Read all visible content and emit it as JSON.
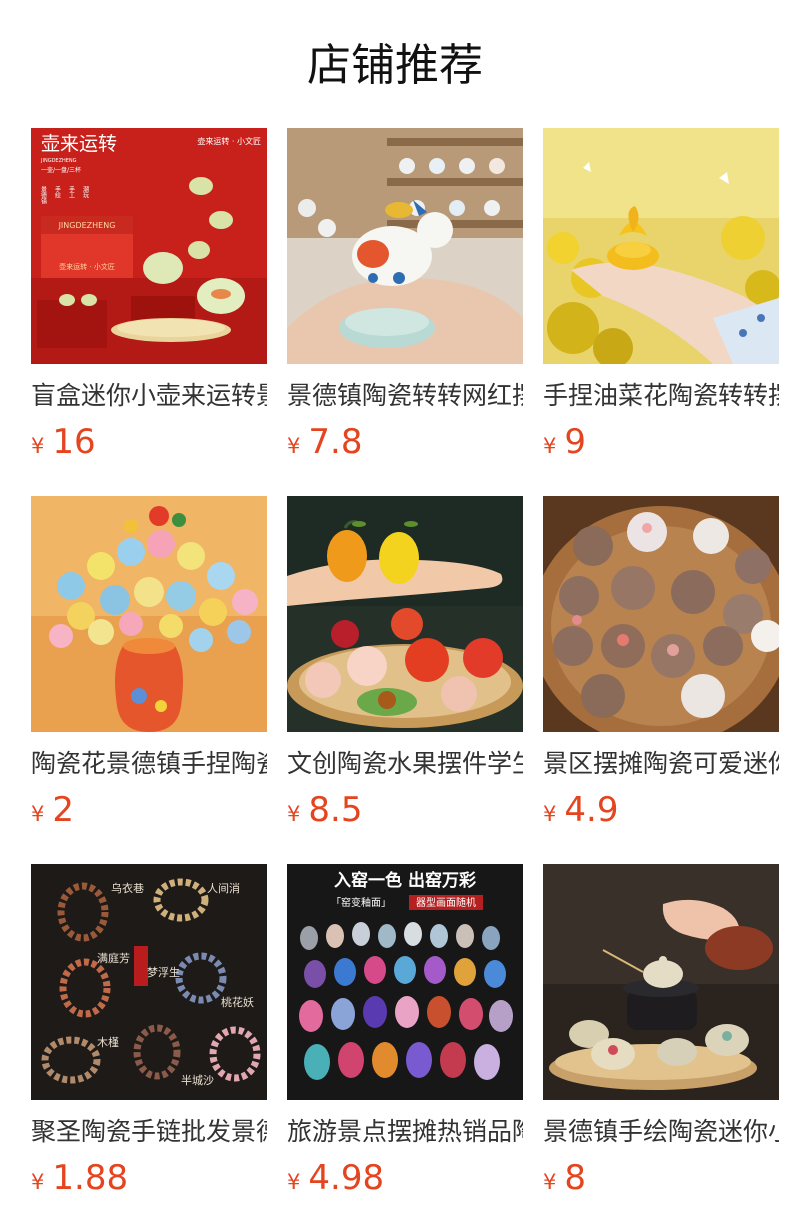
{
  "header": {
    "title": "店铺推荐"
  },
  "currency_symbol": "¥",
  "colors": {
    "price": "#e4441e",
    "title_text": "#333333"
  },
  "products": [
    {
      "title": "盲盒迷你小壶来运转景德镇",
      "price": "16",
      "image": {
        "brand": "壶来运转",
        "brand_small": "壶来运转 · 小文匠",
        "latin": "JINGDEZHENG",
        "box_latin": "JINGDEZHENG",
        "box_label": "壶来运转 · 小文匠",
        "line1": "一壶/一盘/三杯",
        "tags": [
          "景德镇",
          "手绘",
          "手工",
          "潮玩"
        ]
      }
    },
    {
      "title": "景德镇陶瓷转转网红摆件",
      "price": "7.8",
      "image": {}
    },
    {
      "title": "手捏油菜花陶瓷转转摆件",
      "price": "9",
      "image": {}
    },
    {
      "title": "陶瓷花景德镇手捏陶瓷花",
      "price": "2",
      "image": {}
    },
    {
      "title": "文创陶瓷水果摆件学生",
      "price": "8.5",
      "image": {}
    },
    {
      "title": "景区摆摊陶瓷可爱迷你",
      "price": "4.9",
      "image": {}
    },
    {
      "title": "聚圣陶瓷手链批发景德镇",
      "price": "1.88",
      "image": {
        "labels": [
          "乌衣巷",
          "人间消",
          "满庭芳",
          "梦浮生",
          "桃花妖",
          "木槿",
          "半城沙"
        ],
        "stamp": "梦浮生"
      }
    },
    {
      "title": "旅游景点摆摊热销品陶瓷",
      "price": "4.98",
      "image": {
        "headline": "入窑一色 出窑万彩",
        "sub_left": "「窑变釉面」",
        "sub_right": "器型画面随机"
      }
    },
    {
      "title": "景德镇手绘陶瓷迷你小壶",
      "price": "8",
      "image": {}
    }
  ]
}
